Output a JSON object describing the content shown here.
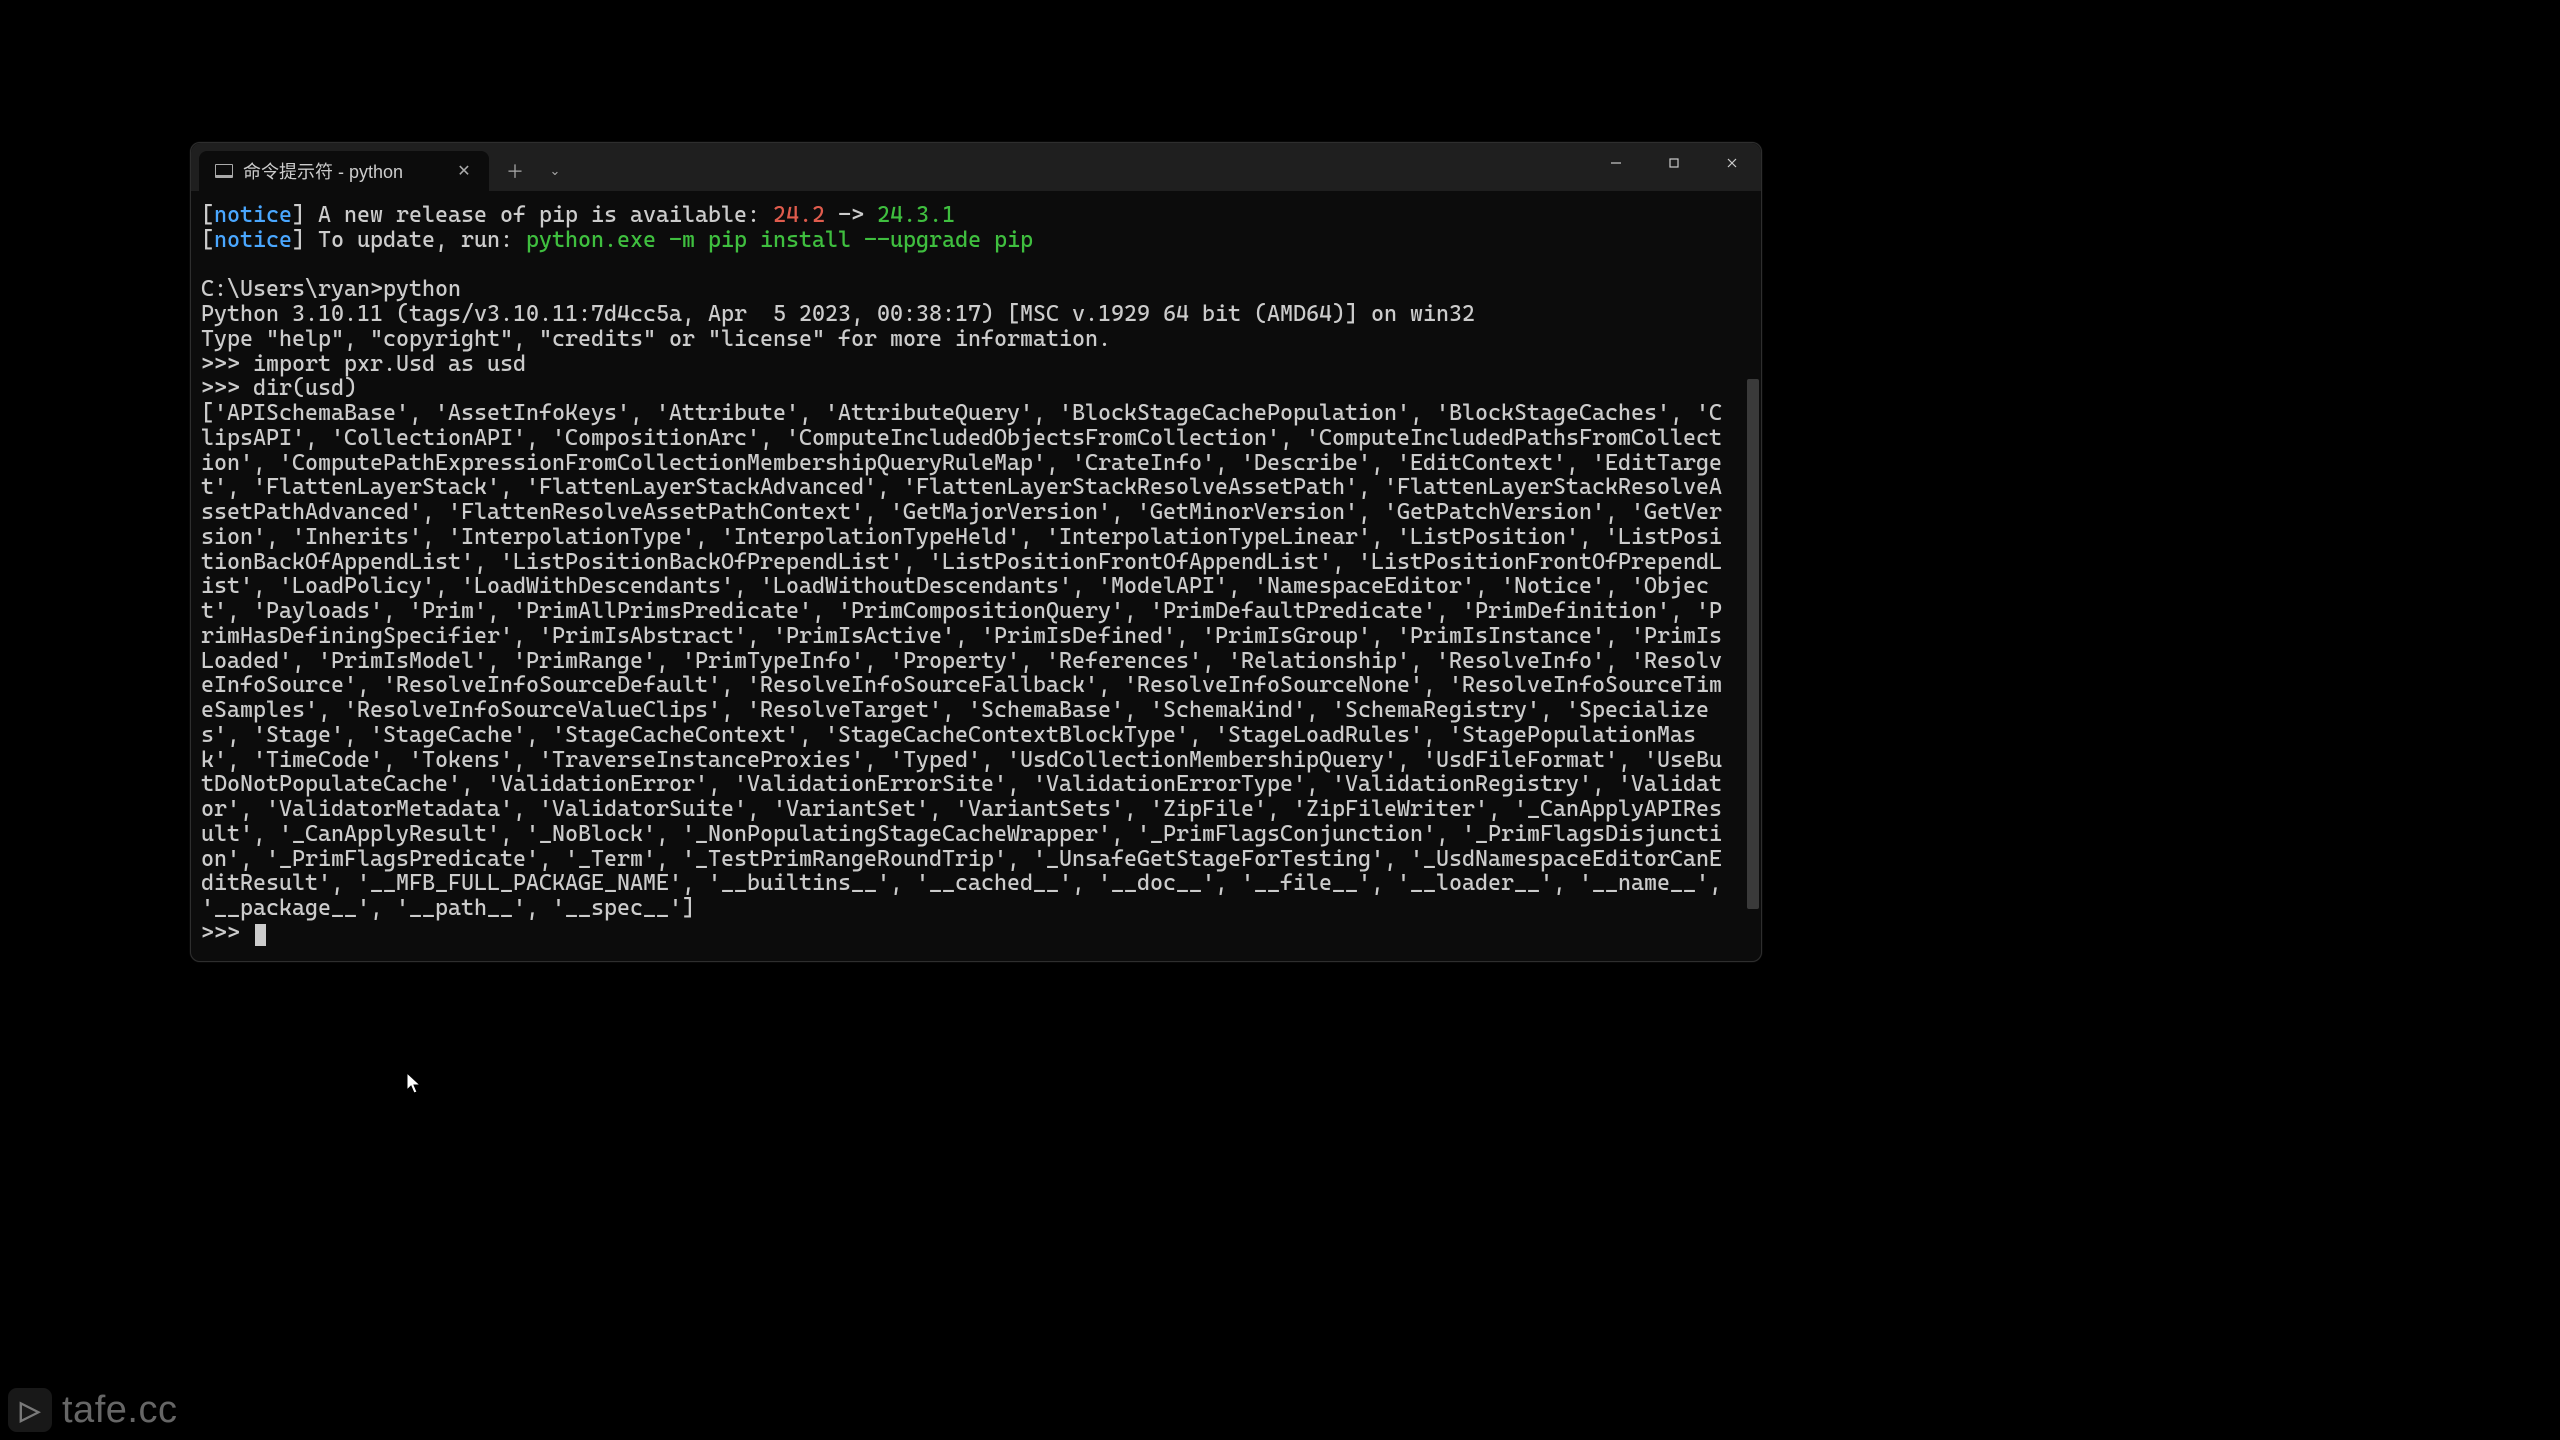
{
  "tab": {
    "title": "命令提示符 - python",
    "close_glyph": "✕",
    "new_tab_glyph": "＋",
    "dropdown_glyph": "⌄"
  },
  "window_controls": {
    "minimize_label": "Minimize",
    "maximize_label": "Maximize",
    "close_label": "Close"
  },
  "notice1": {
    "prefix": "[",
    "tag": "notice",
    "mid": "] A new release of pip is available: ",
    "old": "24.2",
    "arrow": " -> ",
    "new": "24.3.1"
  },
  "notice2": {
    "prefix": "[",
    "tag": "notice",
    "mid": "] To update, run: ",
    "cmd": "python.exe -m pip install --upgrade pip"
  },
  "shell_prompt": "C:\\Users\\ryan>python",
  "py_banner1": "Python 3.10.11 (tags/v3.10.11:7d4cc5a, Apr  5 2023, 00:38:17) [MSC v.1929 64 bit (AMD64)] on win32",
  "py_banner2": "Type \"help\", \"copyright\", \"credits\" or \"license\" for more information.",
  "repl_line1": ">>> import pxr.Usd as usd",
  "repl_line2": ">>> dir(usd)",
  "dir_output": "['APISchemaBase', 'AssetInfoKeys', 'Attribute', 'AttributeQuery', 'BlockStageCachePopulation', 'BlockStageCaches', 'ClipsAPI', 'CollectionAPI', 'CompositionArc', 'ComputeIncludedObjectsFromCollection', 'ComputeIncludedPathsFromCollection', 'ComputePathExpressionFromCollectionMembershipQueryRuleMap', 'CrateInfo', 'Describe', 'EditContext', 'EditTarget', 'FlattenLayerStack', 'FlattenLayerStackAdvanced', 'FlattenLayerStackResolveAssetPath', 'FlattenLayerStackResolveAssetPathAdvanced', 'FlattenResolveAssetPathContext', 'GetMajorVersion', 'GetMinorVersion', 'GetPatchVersion', 'GetVersion', 'Inherits', 'InterpolationType', 'InterpolationTypeHeld', 'InterpolationTypeLinear', 'ListPosition', 'ListPositionBackOfAppendList', 'ListPositionBackOfPrependList', 'ListPositionFrontOfAppendList', 'ListPositionFrontOfPrependList', 'LoadPolicy', 'LoadWithDescendants', 'LoadWithoutDescendants', 'ModelAPI', 'NamespaceEditor', 'Notice', 'Object', 'Payloads', 'Prim', 'PrimAllPrimsPredicate', 'PrimCompositionQuery', 'PrimDefaultPredicate', 'PrimDefinition', 'PrimHasDefiningSpecifier', 'PrimIsAbstract', 'PrimIsActive', 'PrimIsDefined', 'PrimIsGroup', 'PrimIsInstance', 'PrimIsLoaded', 'PrimIsModel', 'PrimRange', 'PrimTypeInfo', 'Property', 'References', 'Relationship', 'ResolveInfo', 'ResolveInfoSource', 'ResolveInfoSourceDefault', 'ResolveInfoSourceFallback', 'ResolveInfoSourceNone', 'ResolveInfoSourceTimeSamples', 'ResolveInfoSourceValueClips', 'ResolveTarget', 'SchemaBase', 'SchemaKind', 'SchemaRegistry', 'Specializes', 'Stage', 'StageCache', 'StageCacheContext', 'StageCacheContextBlockType', 'StageLoadRules', 'StagePopulationMask', 'TimeCode', 'Tokens', 'TraverseInstanceProxies', 'Typed', 'UsdCollectionMembershipQuery', 'UsdFileFormat', 'UseButDoNotPopulateCache', 'ValidationError', 'ValidationErrorSite', 'ValidationErrorType', 'ValidationRegistry', 'Validator', 'ValidatorMetadata', 'ValidatorSuite', 'VariantSet', 'VariantSets', 'ZipFile', 'ZipFileWriter', '_CanApplyAPIResult', '_CanApplyResult', '_NoBlock', '_NonPopulatingStageCacheWrapper', '_PrimFlagsConjunction', '_PrimFlagsDisjunction', '_PrimFlagsPredicate', '_Term', '_TestPrimRangeRoundTrip', '_UnsafeGetStageForTesting', '_UsdNamespaceEditorCanEditResult', '__MFB_FULL_PACKAGE_NAME', '__builtins__', '__cached__', '__doc__', '__file__', '__loader__', '__name__', '__package__', '__path__', '__spec__']",
  "repl_prompt": ">>> ",
  "watermark": {
    "icon_glyph": "▷",
    "text": "tafe.cc"
  }
}
